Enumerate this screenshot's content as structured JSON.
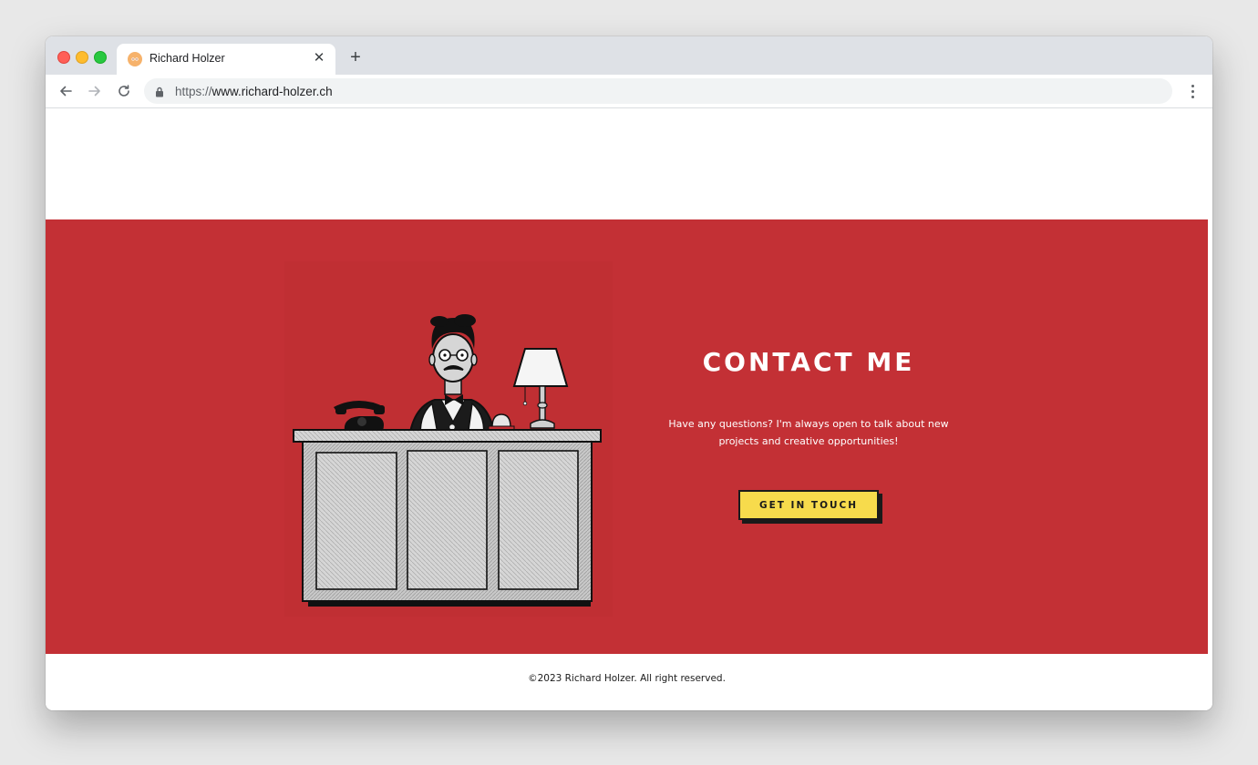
{
  "browser": {
    "tab_title": "Richard Holzer",
    "url_scheme": "https://",
    "url_host": "www.richard-holzer.ch",
    "new_tab_symbol": "+",
    "close_symbol": "✕"
  },
  "hero": {
    "background_color": "#c33035",
    "heading": "CONTACT ME",
    "description": "Have any questions? I'm always open to talk about new projects and creative opportunities!",
    "cta_label": "GET IN TOUCH",
    "cta_color": "#f7db4c"
  },
  "footer": {
    "copyright": "©2023 Richard Holzer. All right reserved."
  },
  "icons": {
    "favicon": "richard-holzer-favicon",
    "back": "back-arrow-icon",
    "forward": "forward-arrow-icon",
    "reload": "reload-icon",
    "lock": "lock-icon",
    "menu": "kebab-menu-icon"
  }
}
